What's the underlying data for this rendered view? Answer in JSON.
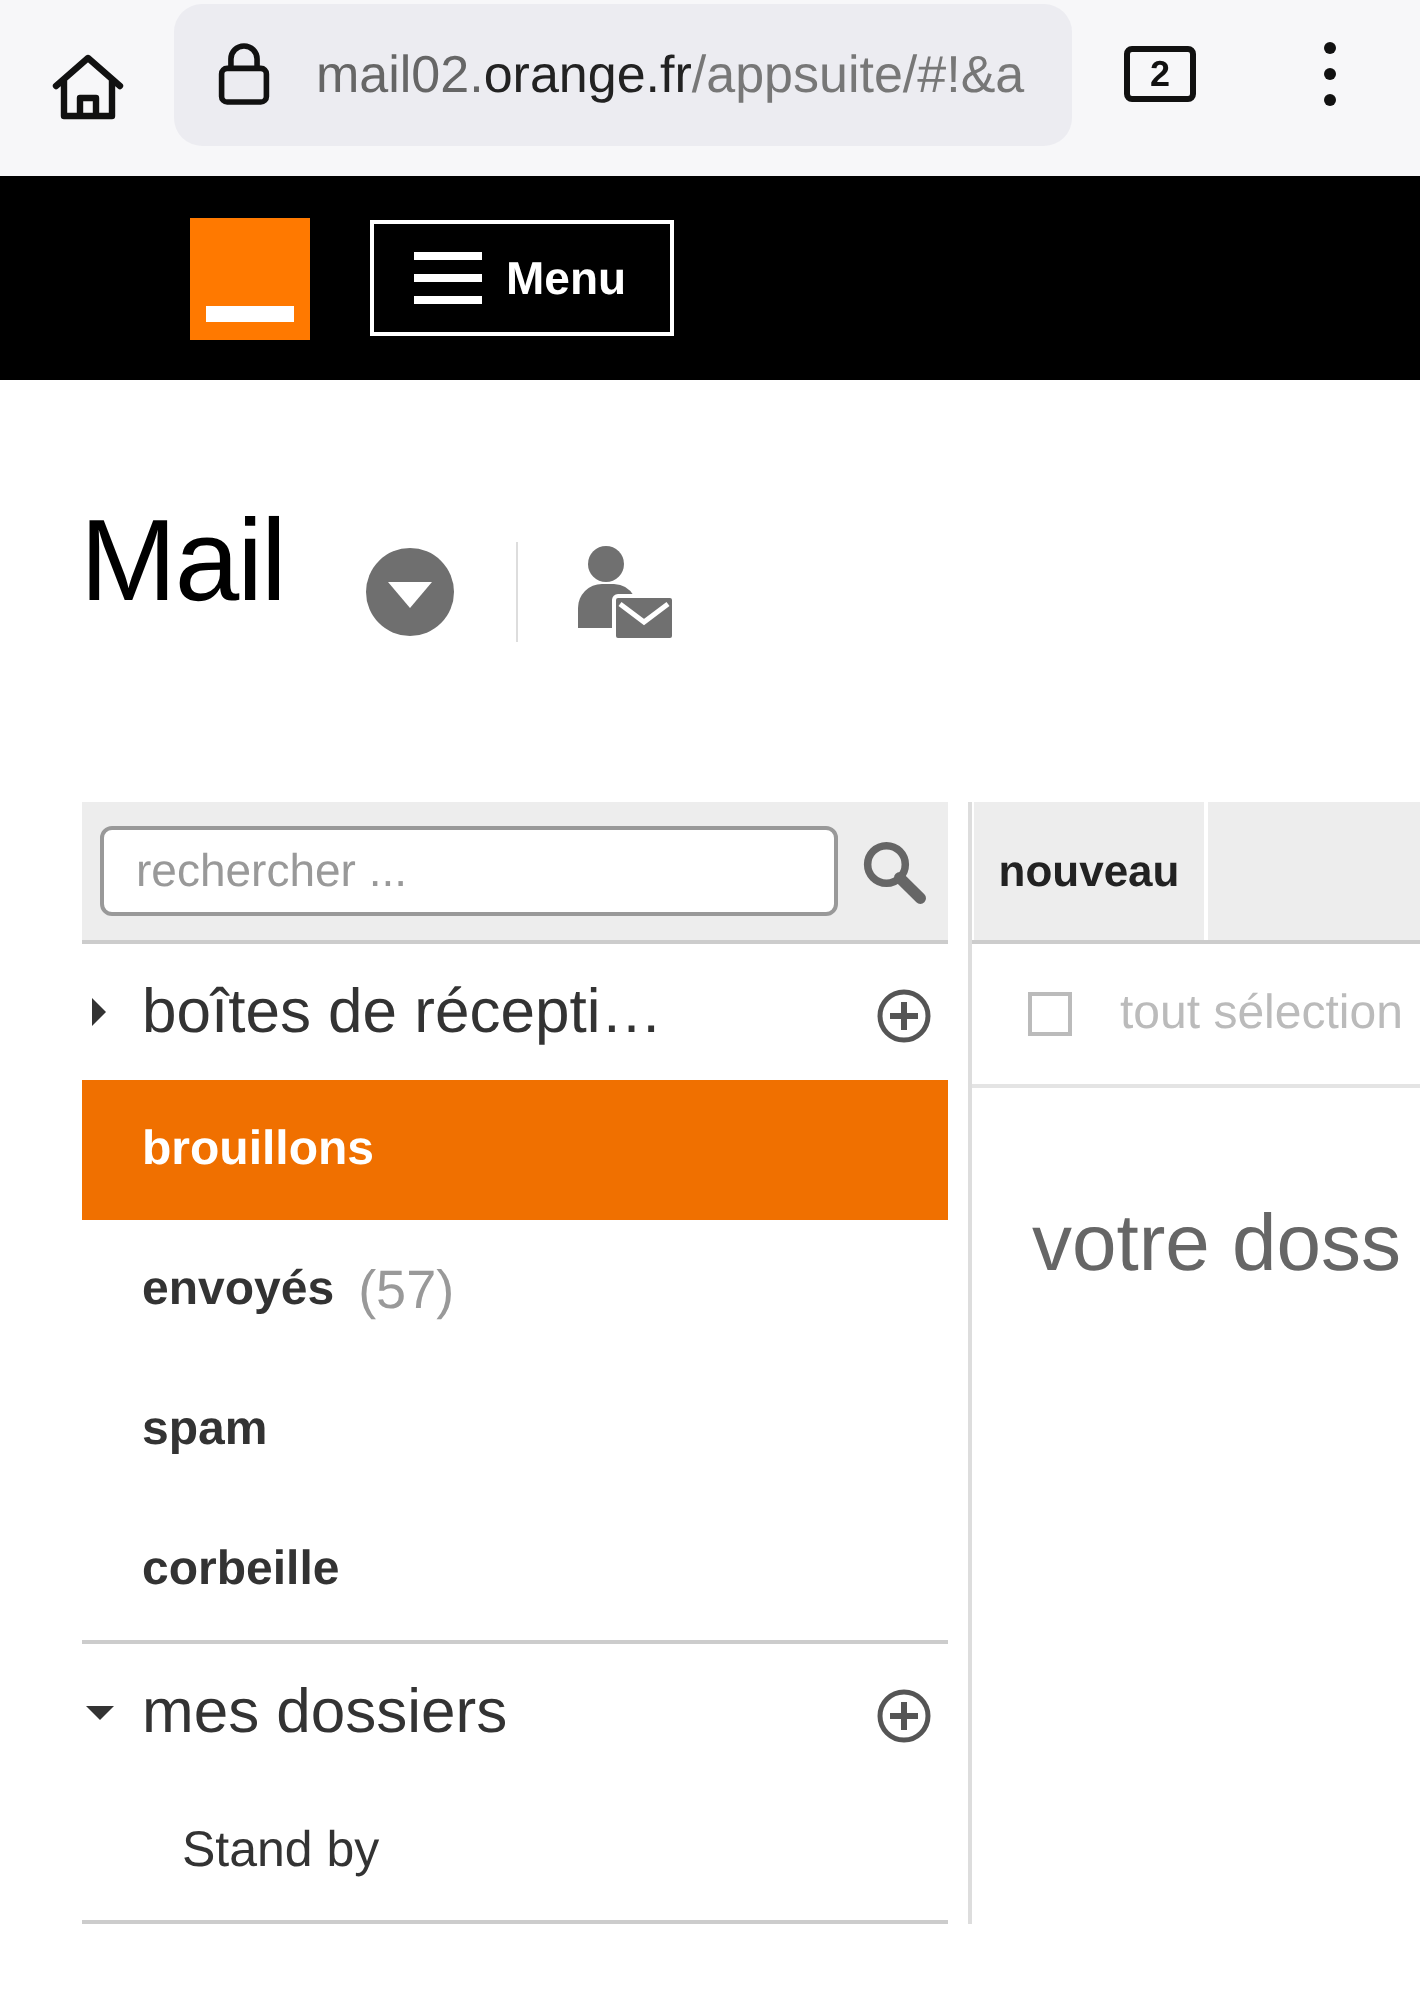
{
  "browser": {
    "url": {
      "prefix": "mail02.",
      "domain": "orange.fr",
      "path": "/appsuite/#!&a"
    },
    "tab_count": "2"
  },
  "header": {
    "menu_label": "Menu"
  },
  "app": {
    "title": "Mail"
  },
  "search": {
    "placeholder": "rechercher ..."
  },
  "toolbar": {
    "new_label": "nouveau"
  },
  "sections": [
    {
      "title": "boîtes de récepti…",
      "expanded": false,
      "kind": "system",
      "folders": [
        {
          "name": "brouillons",
          "selected": true
        },
        {
          "name": "envoyés",
          "count": "(57)",
          "selected": false
        },
        {
          "name": "spam",
          "selected": false
        },
        {
          "name": "corbeille",
          "selected": false
        }
      ]
    },
    {
      "title": "mes dossiers",
      "expanded": true,
      "kind": "custom",
      "folders": [
        {
          "name": "Stand by",
          "selected": false
        }
      ]
    }
  ],
  "list": {
    "select_all_label": "tout sélection",
    "select_all_checked": false,
    "empty_message": "votre doss"
  }
}
